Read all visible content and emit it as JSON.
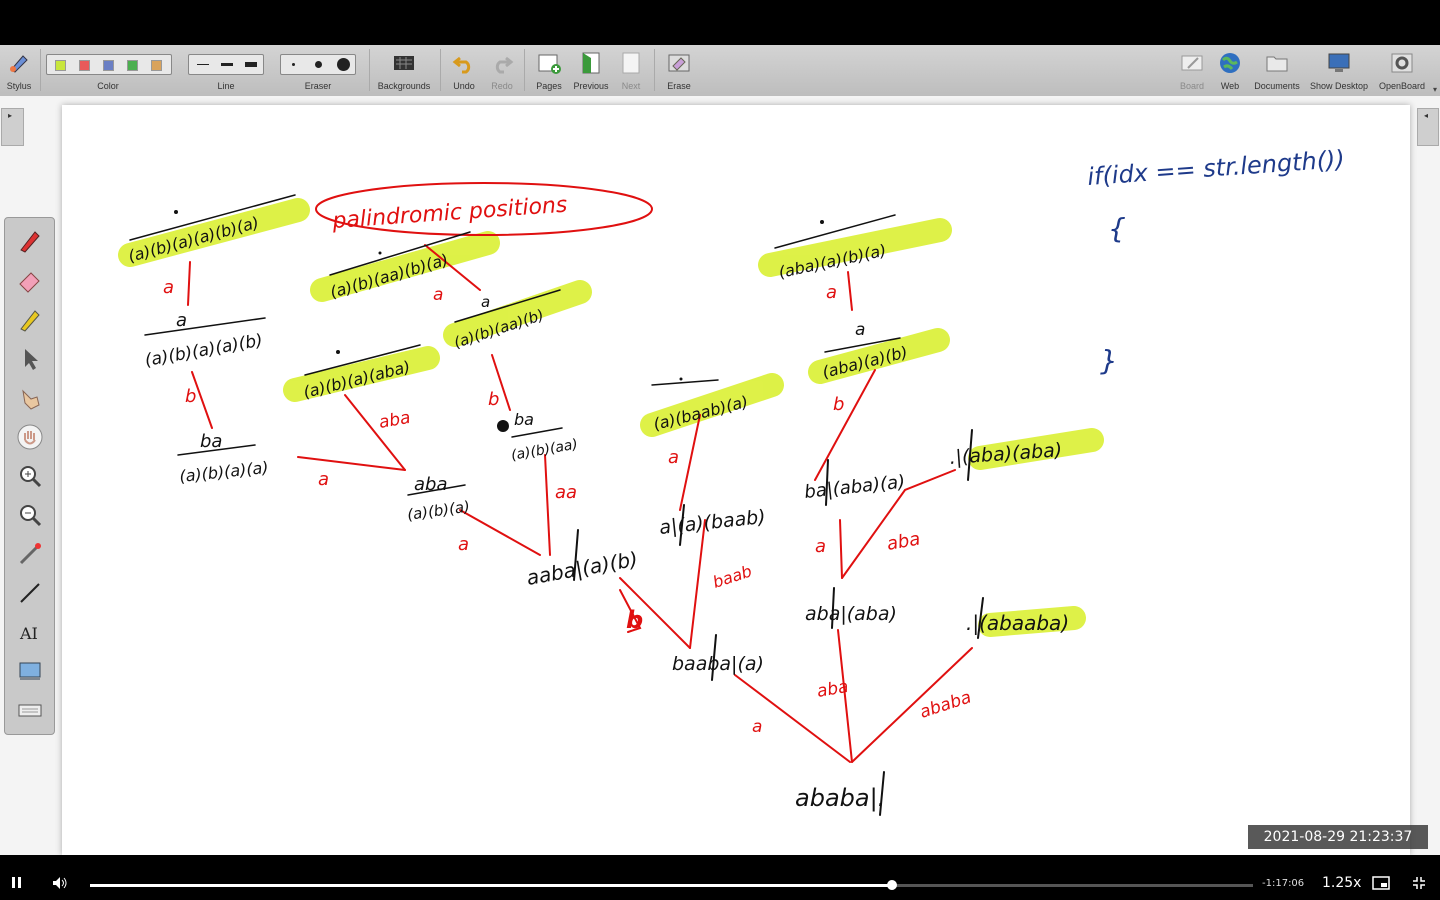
{
  "toolbar": {
    "left_tools": [
      {
        "label": "Stylus"
      },
      {
        "label": "Color"
      },
      {
        "label": "Line"
      },
      {
        "label": "Eraser"
      },
      {
        "label": "Backgrounds"
      },
      {
        "label": "Undo"
      },
      {
        "label": "Redo"
      },
      {
        "label": "Pages"
      },
      {
        "label": "Previous"
      },
      {
        "label": "Next"
      },
      {
        "label": "Erase"
      }
    ],
    "right_tools": [
      {
        "label": "Board"
      },
      {
        "label": "Web"
      },
      {
        "label": "Documents"
      },
      {
        "label": "Show Desktop"
      },
      {
        "label": "OpenBoard"
      }
    ],
    "colors": [
      "#c8e63c",
      "#e85a5a",
      "#6a7fc4",
      "#4caf50",
      "#d9a35c"
    ]
  },
  "dock_tools": [
    "pen-icon",
    "eraser-icon",
    "highlighter-icon",
    "pointer-icon",
    "hand-pointer-icon",
    "grab-hand-icon",
    "zoom-in-icon",
    "zoom-out-icon",
    "laser-pointer-icon",
    "line-icon",
    "text-icon",
    "capture-icon",
    "keyboard-icon"
  ],
  "board": {
    "title": "palindromic positions",
    "code_line": "if(idx == str.length())",
    "code_open": "{",
    "code_close": "}",
    "nodes": {
      "root": "ababa|.",
      "n_baaba": "baaba|(a)",
      "n_aaba": "aaba|(a)(b)",
      "n_aba_aba": "aba|(aba)",
      "n_abaaba": ".|(abaaba)",
      "n_aba_small": "aba",
      "n_aba_small_sub": "(a)(b)(a)",
      "n_ba": "ba",
      "n_ba_sub": "(a)(b)(a)(a)",
      "n_a": "a",
      "n_a_sub": "(a)(b)(a)(a)(b)",
      "n_top1": "(a)(b)(a)(a)(b)(a)",
      "n_abaa": "(a)(b)(a)(aba)",
      "n_aa": "(a)(b)(aa)(b)(a)",
      "n_a2": "a",
      "n_a2_sub": "(a)(b)(aa)(b)",
      "n_ba2": "ba",
      "n_ba2_sub": "(a)(b)(aa)",
      "n_a_baab": "a|(a)(baab)",
      "n_abaab": "(a)(baab)(a)",
      "n_ba_aba": "ba|(aba)(a)",
      "n_a3": "a",
      "n_a3_sub": "(aba)(a)(b)",
      "n_abaa2": "(aba)(a)(b)(a)",
      "n_aba_aba2": ".|(aba)(aba)"
    },
    "edges": {
      "e_a1": "a",
      "e_aba1": "aba",
      "e_ababa": "ababa",
      "e_b": "b",
      "e_baab": "baab",
      "e_a2": "a",
      "e_aa": "aa",
      "e_a3": "a",
      "e_aba2": "aba",
      "e_a4": "a",
      "e_b2": "b",
      "e_a5": "a",
      "e_a6": "a",
      "e_b3": "b",
      "e_a7": "a",
      "e_b4": "b",
      "e_a8": "a",
      "e_a9": "a",
      "e_aba3": "aba"
    }
  },
  "timestamp": "2021-08-29  21:23:37",
  "player": {
    "time_remaining": "-1:17:06",
    "speed": "1.25x",
    "progress_fraction": 0.69
  }
}
